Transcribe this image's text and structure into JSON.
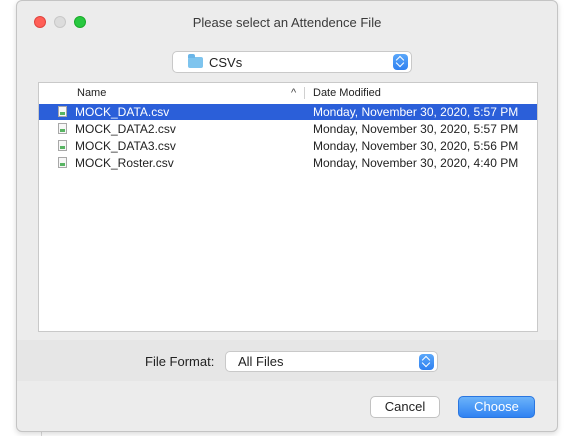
{
  "window": {
    "title": "Please select an Attendence File"
  },
  "location": {
    "folder": "CSVs",
    "folder_icon": "folder-icon",
    "stepper_icon": "up-down-stepper-icon"
  },
  "file_list": {
    "columns": {
      "name": "Name",
      "date_modified": "Date Modified",
      "sort_indicator": "^"
    },
    "rows": [
      {
        "name": "MOCK_DATA.csv",
        "date": "Monday, November 30, 2020, 5:57 PM",
        "selected": true
      },
      {
        "name": "MOCK_DATA2.csv",
        "date": "Monday, November 30, 2020, 5:57 PM",
        "selected": false
      },
      {
        "name": "MOCK_DATA3.csv",
        "date": "Monday, November 30, 2020, 5:56 PM",
        "selected": false
      },
      {
        "name": "MOCK_Roster.csv",
        "date": "Monday, November 30, 2020, 4:40 PM",
        "selected": false
      }
    ]
  },
  "format": {
    "label": "File Format:",
    "value": "All Files"
  },
  "buttons": {
    "cancel": "Cancel",
    "choose": "Choose"
  },
  "colors": {
    "selection": "#2b5fd9",
    "accent": "#2f82f2",
    "close": "#ff5f57",
    "maximize": "#28c840"
  }
}
